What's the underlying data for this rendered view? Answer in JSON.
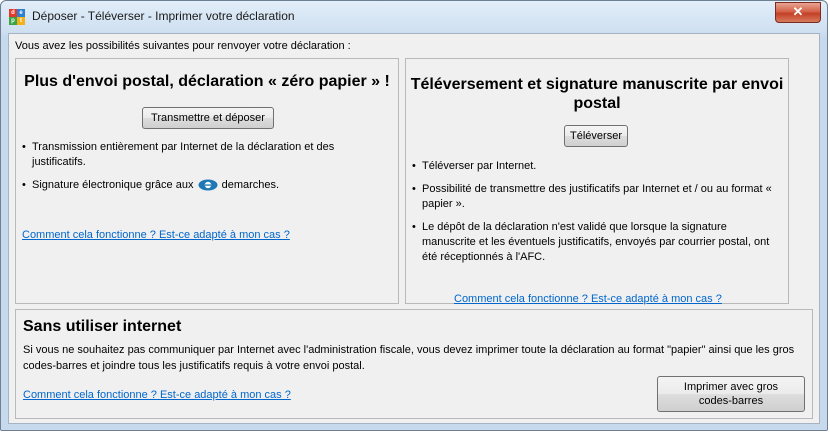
{
  "window": {
    "title": "Déposer - Téléverser - Imprimer votre déclaration",
    "close_label": "✕",
    "app_icon_letters": [
      "d",
      "e",
      "p",
      "t"
    ],
    "app_icon_colors": [
      "#e2392b",
      "#2d7fd2",
      "#3aa346",
      "#f2b21b"
    ]
  },
  "intro": "Vous avez les possibilités suivantes pour renvoyer votre déclaration :",
  "panel_postal": {
    "title": "Plus d'envoi postal, déclaration « zéro papier » !",
    "button": "Transmettre et déposer",
    "bullets": [
      "Transmission entièrement par Internet de la déclaration et des justificatifs.",
      "Signature électronique grâce aux",
      "demarches."
    ],
    "link": "Comment cela fonctionne ? Est-ce adapté à mon cas ?"
  },
  "panel_upload": {
    "title": "Téléversement et signature manuscrite par envoi postal",
    "button": "Téléverser",
    "bullets": [
      "Téléverser par Internet.",
      "Possibilité de transmettre des justificatifs par Internet et / ou au format « papier ».",
      "Le dépôt de la déclaration n'est validé que lorsque la signature manuscrite et les éventuels justificatifs, envoyés par courrier postal, ont été réceptionnés à l'AFC."
    ],
    "link": "Comment cela fonctionne ? Est-ce adapté à mon cas ?"
  },
  "panel_offline": {
    "title": "Sans utiliser internet",
    "text": "Si vous ne souhaitez pas communiquer par Internet avec l'administration fiscale, vous devez imprimer toute la déclaration au format \"papier\" ainsi que les gros codes-barres et joindre tous les justificatifs requis à votre envoi postal.",
    "link": "Comment cela fonctionne ? Est-ce adapté à mon cas ?",
    "button_line1": "Imprimer avec gros",
    "button_line2": "codes-barres"
  },
  "icons": {
    "edemarches": "e-demarches-logo-icon",
    "close": "close-icon",
    "app": "app-icon"
  },
  "colors": {
    "link": "#0066cc",
    "close": "#c24127",
    "edemarches_blue": "#1f78b4"
  }
}
